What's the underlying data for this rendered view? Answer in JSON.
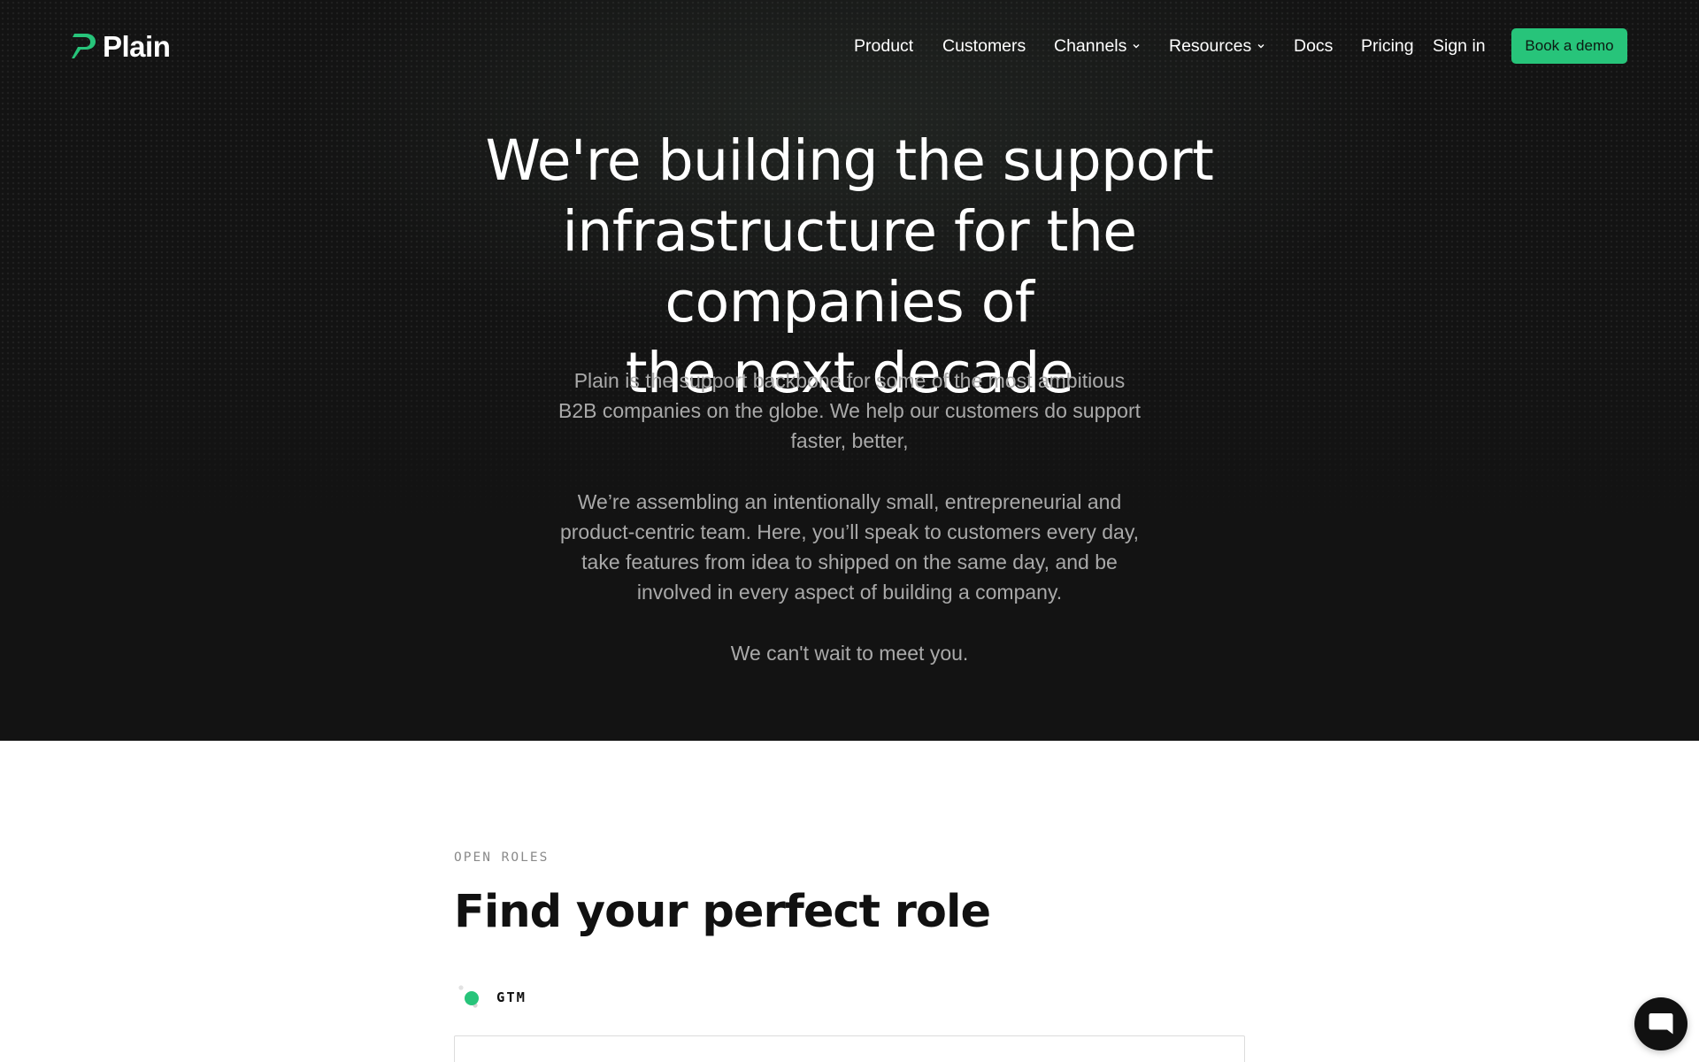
{
  "brand": {
    "name": "Plain",
    "accent": "#27c47a",
    "hero_bg": "#131313"
  },
  "nav": {
    "items": [
      {
        "label": "Product"
      },
      {
        "label": "Customers"
      },
      {
        "label": "Channels",
        "icon": "chevron-down-icon"
      },
      {
        "label": "Resources",
        "icon": "chevron-down-icon"
      },
      {
        "label": "Docs"
      },
      {
        "label": "Pricing"
      }
    ],
    "sign_in": "Sign in",
    "cta": "Book a demo"
  },
  "hero": {
    "headline_lines": [
      "We're building the support",
      "infrastructure for the companies of",
      "the next decade"
    ],
    "paragraph_1_lines": [
      "Plain is the support backbone for some of the most ambitious",
      "B2B companies on the globe. We help our customers do support",
      "faster, better,"
    ],
    "paragraph_2_lines": [
      "We’re assembling an intentionally small, entrepreneurial and",
      "product-centric team. Here, you’ll speak to customers every day,",
      "take features from idea to shipped on the same day, and be",
      "involved in every aspect of building a company."
    ],
    "closing": "We can't wait to meet you."
  },
  "roles": {
    "eyebrow": "OPEN ROLES",
    "title": "Find your perfect role",
    "category": {
      "label": "GTM",
      "icon": "status-dot-icon"
    }
  },
  "chat": {
    "icon": "chat-bubble-icon"
  }
}
